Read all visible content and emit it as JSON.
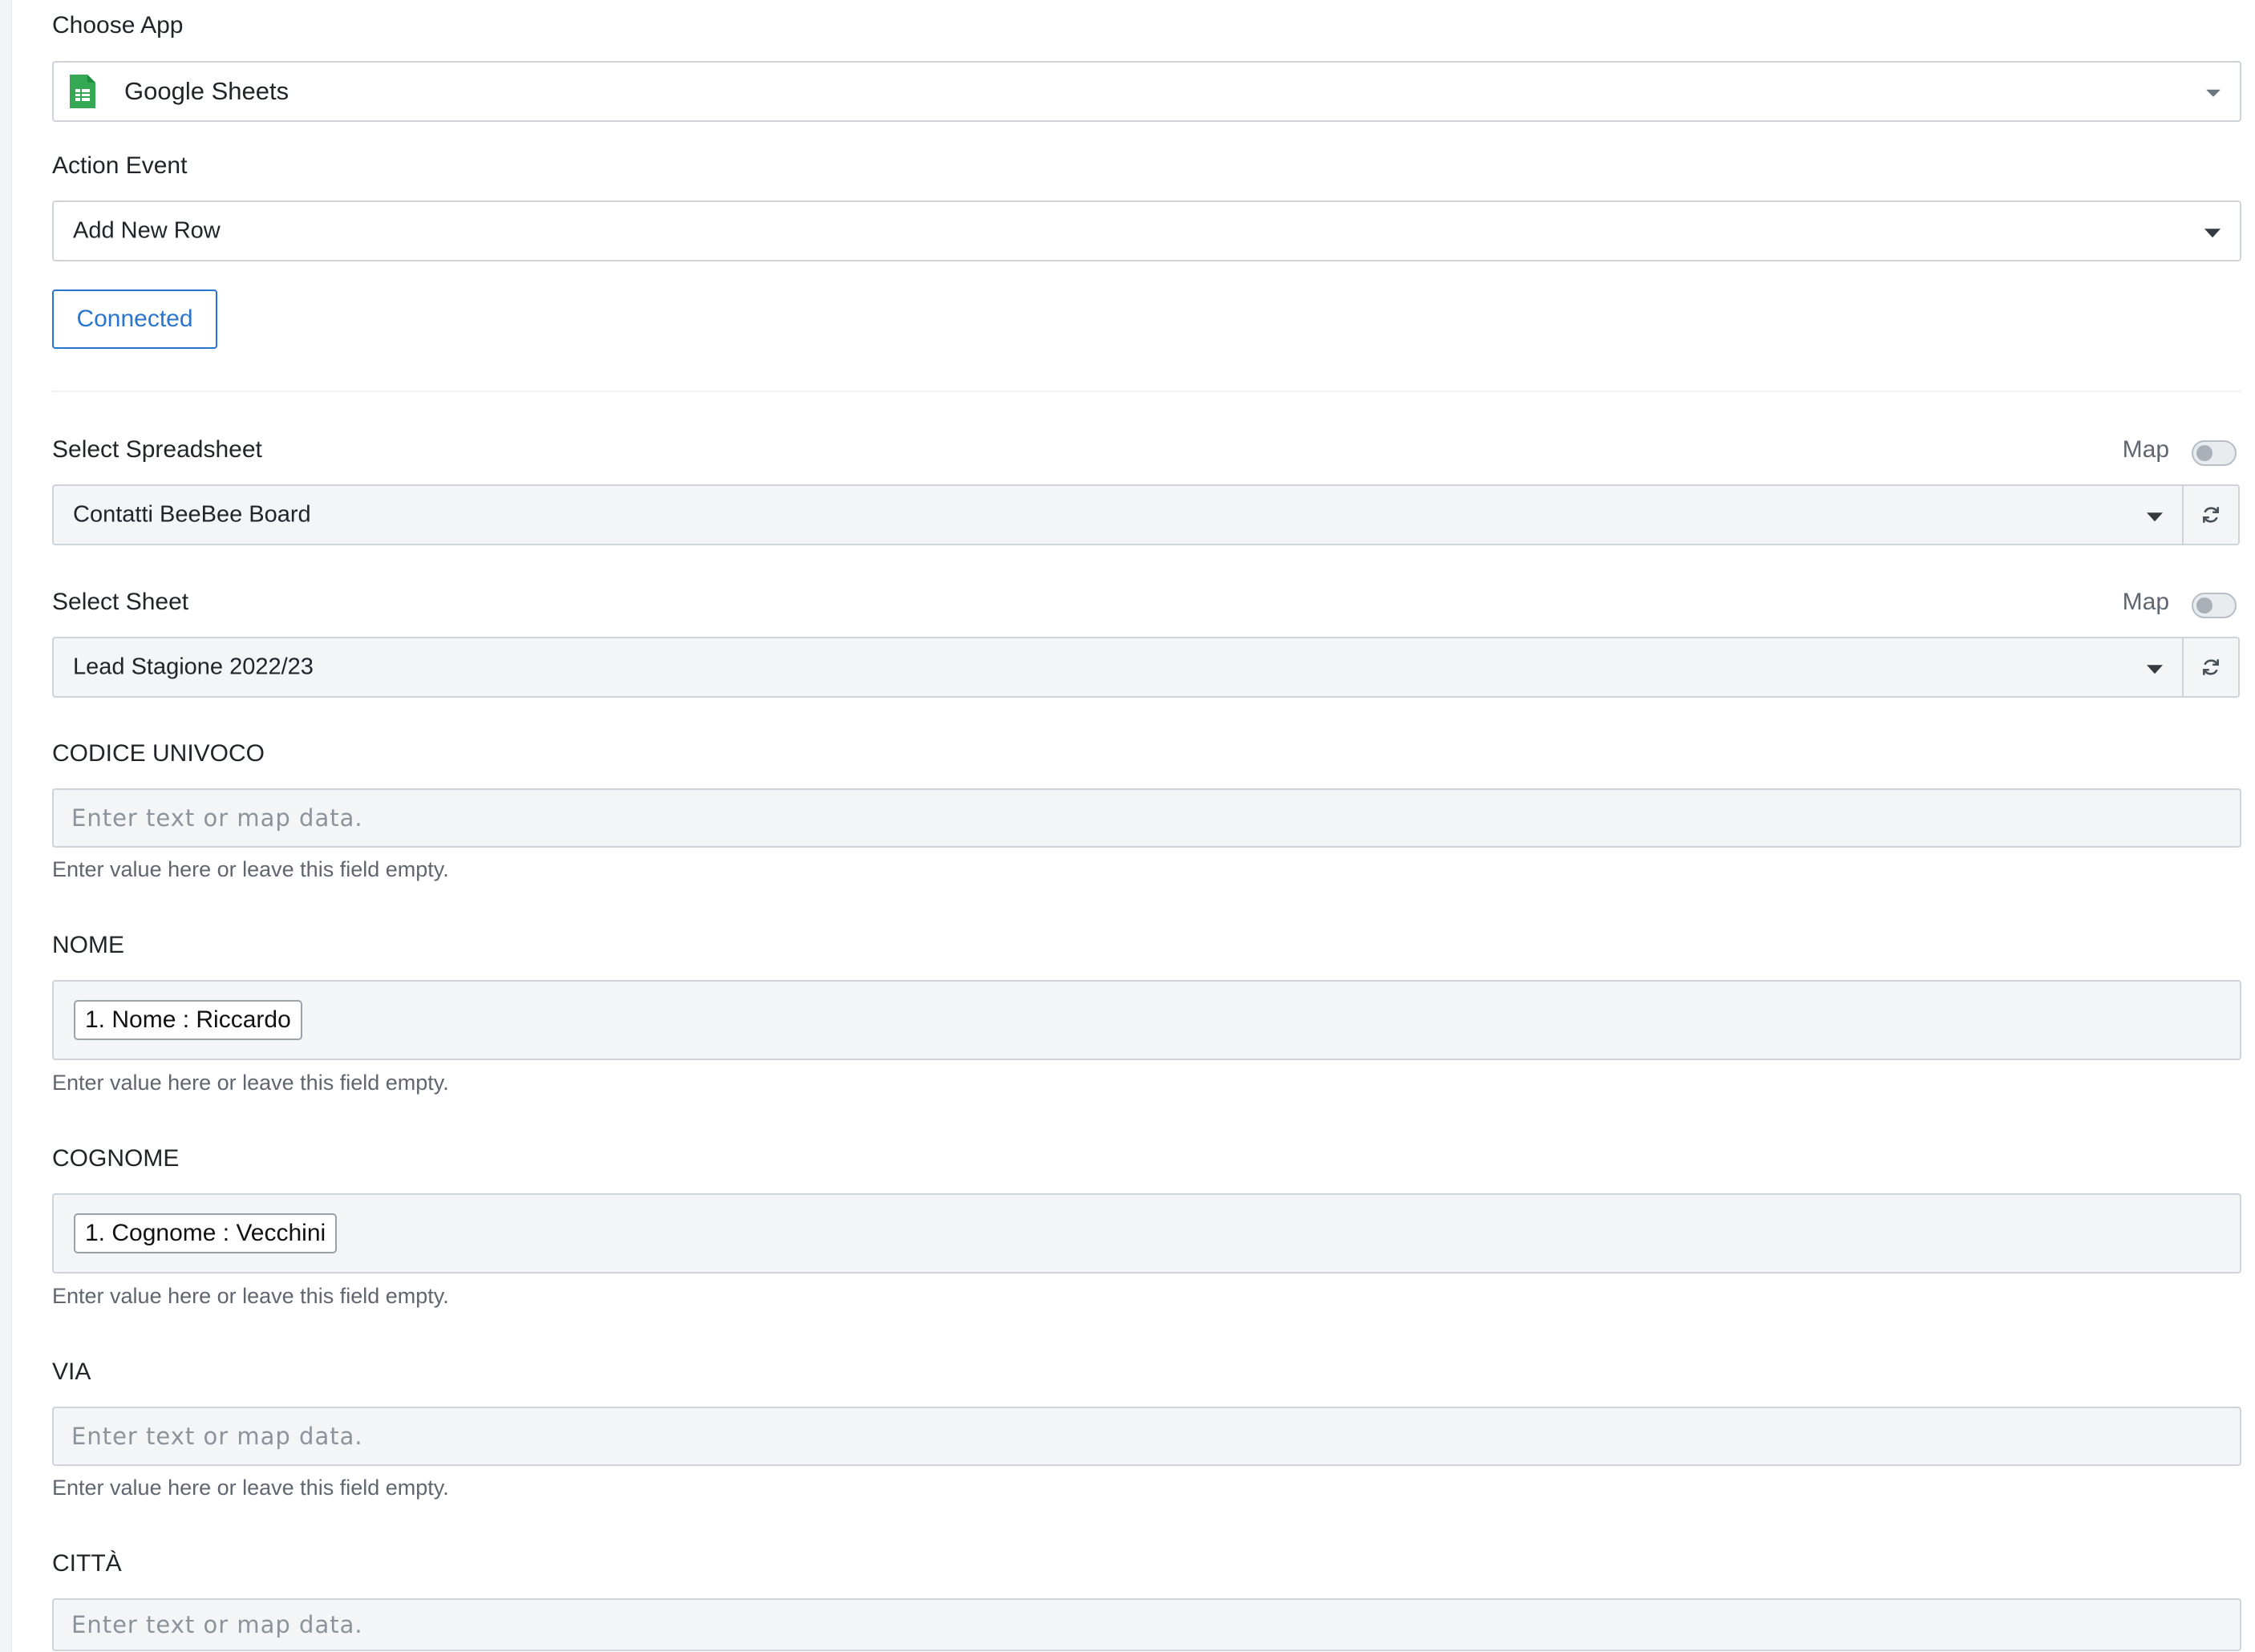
{
  "choose_app": {
    "label": "Choose App",
    "value": "Google Sheets",
    "icon": "google-sheets-icon",
    "accent": "#34a853"
  },
  "action_event": {
    "label": "Action Event",
    "value": "Add New Row"
  },
  "connection": {
    "button_label": "Connected",
    "color": "#2a76cf"
  },
  "spreadsheet": {
    "label": "Select Spreadsheet",
    "map_label": "Map",
    "value": "Contatti BeeBee Board",
    "map_enabled": false
  },
  "sheet": {
    "label": "Select Sheet",
    "map_label": "Map",
    "value": "Lead Stagione 2022/23",
    "map_enabled": false
  },
  "fields": [
    {
      "label": "CODICE UNIVOCO",
      "placeholder": "Enter text or map data.",
      "chip": null,
      "help": "Enter value here or leave this field empty."
    },
    {
      "label": "NOME",
      "placeholder": "",
      "chip": "1. Nome : Riccardo",
      "help": "Enter value here or leave this field empty."
    },
    {
      "label": "COGNOME",
      "placeholder": "",
      "chip": "1. Cognome : Vecchini",
      "help": "Enter value here or leave this field empty."
    },
    {
      "label": "VIA",
      "placeholder": "Enter text or map data.",
      "chip": null,
      "help": "Enter value here or leave this field empty."
    },
    {
      "label": "CITTÀ",
      "placeholder": "Enter text or map data.",
      "chip": null,
      "help": ""
    }
  ]
}
